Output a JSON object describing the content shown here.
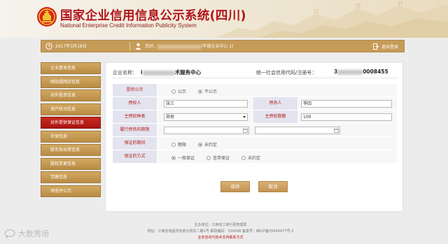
{
  "header": {
    "title": "国家企业信用信息公示系统(四川)",
    "subtitle": "National Enterprise Credit Information Publicity System"
  },
  "statusbar": {
    "date": "2017年3月18日",
    "welcome_prefix": "您好，",
    "welcome_suffix": "(年报企业中心 1)",
    "logout_label": "退出登录"
  },
  "sidebar": {
    "items": [
      {
        "label": "企业基本信息"
      },
      {
        "label": "网站或网店信息"
      },
      {
        "label": "对外投资信息"
      },
      {
        "label": "资产状况信息"
      },
      {
        "label": "对外提供保证信息",
        "active": true
      },
      {
        "label": "社保信息"
      },
      {
        "label": "股东及出资信息"
      },
      {
        "label": "股权变更信息"
      },
      {
        "label": "党建信息"
      },
      {
        "label": "预览并公示"
      }
    ]
  },
  "company": {
    "name_label": "企业名称：",
    "name_prefix": "i",
    "name_suffix": "术服务中心",
    "code_label": "统一社会信用代码/注册号：",
    "code_prefix": "3",
    "code_suffix": "0008455"
  },
  "form": {
    "publish_label": "是否公示",
    "publish_options": [
      "公示",
      "不公示"
    ],
    "publish_selected": "不公示",
    "creditor_label": "债权人",
    "creditor_value": "张三",
    "debtor_label": "债务人",
    "debtor_value": "李四",
    "claim_type_label": "主债权种类",
    "claim_type_value": "其他",
    "claim_amount_label": "主债权数额",
    "claim_amount_value": "100",
    "period_label": "履行债务的期限",
    "guarantee_period_label": "保证的期间",
    "guarantee_period_options": [
      "期限",
      "未约定"
    ],
    "guarantee_period_selected": "未约定",
    "guarantee_method_label": "保证的方式",
    "guarantee_method_options": [
      "一般保证",
      "连带保证",
      "未约定"
    ],
    "guarantee_method_selected": "一般保证"
  },
  "buttons": {
    "save": "保存",
    "cancel": "取消"
  },
  "footer": {
    "line1": "主办单位：江西省工商行政管理局",
    "line2": "地址：江西省南昌市省府大院东二路1号   邮政编码：330046   备案号：赣ICP备05004477号-3",
    "line3": "业务咨询与技术支持联系方式"
  },
  "watermark": {
    "text": "大数秀场"
  },
  "colors": {
    "brand_red": "#b2151c",
    "gold": "#c69b58",
    "active_nav": "#b81c14",
    "label_bg": "#e4e4f0"
  }
}
